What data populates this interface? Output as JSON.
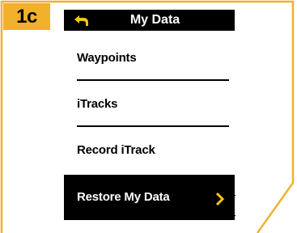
{
  "step": {
    "label": "1c"
  },
  "screen": {
    "title": "My Data",
    "menu": [
      {
        "label": "Waypoints"
      },
      {
        "label": "iTracks"
      },
      {
        "label": "Record iTrack"
      },
      {
        "label": "Restore My Data"
      }
    ]
  },
  "colors": {
    "accent": "#f0b22a",
    "selected_bg": "#000000",
    "chevron": "#f2c418"
  },
  "icons": {
    "back": "back-arrow-icon",
    "selection": "chevron-right-icon"
  }
}
